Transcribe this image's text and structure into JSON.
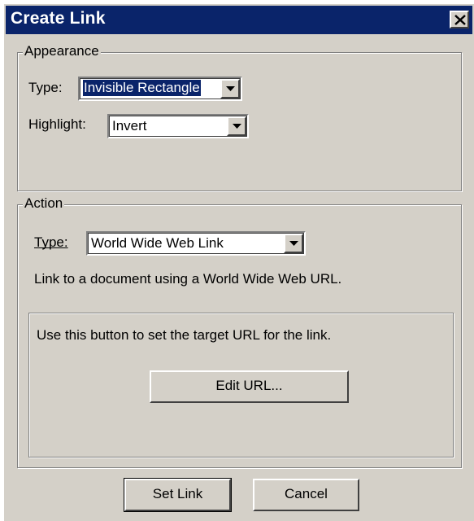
{
  "window": {
    "title": "Create Link"
  },
  "appearance": {
    "group_label": "Appearance",
    "type_label": "Type:",
    "type_value": "Invisible Rectangle",
    "highlight_label": "Highlight:",
    "highlight_value": "Invert"
  },
  "action": {
    "group_label": "Action",
    "type_label": "Type:",
    "type_value": "World Wide Web Link",
    "description": "Link to a document using a World Wide Web URL.",
    "url_hint": "Use this button to set the target URL for the link.",
    "edit_url_label": "Edit URL..."
  },
  "footer": {
    "set_link_label": "Set Link",
    "cancel_label": "Cancel"
  },
  "icons": {
    "close": "close-icon",
    "dropdown": "chevron-down-icon"
  },
  "colors": {
    "titlebar": "#0a246a",
    "face": "#d4d0c8",
    "selection": "#0a246a"
  }
}
